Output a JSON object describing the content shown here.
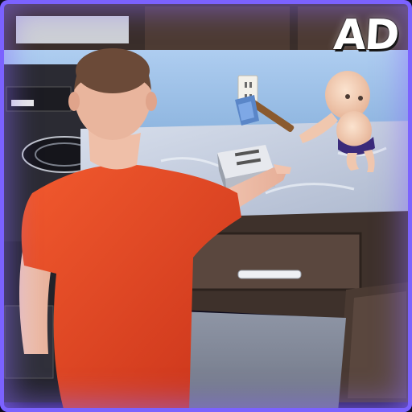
{
  "badge": {
    "text": "AD"
  },
  "scene": {
    "characters": [
      "man-in-orange-shirt",
      "baby-with-hammer"
    ],
    "objects": [
      "toaster",
      "hammer",
      "stove",
      "wall-outlet",
      "drawer",
      "countertop"
    ]
  },
  "colors": {
    "shirt": "#e8431f",
    "wall": "#9fc4ea",
    "counter": "#c9d2e2",
    "cabinet": "#4a3a32",
    "frame_glow": "#6a54ff"
  }
}
